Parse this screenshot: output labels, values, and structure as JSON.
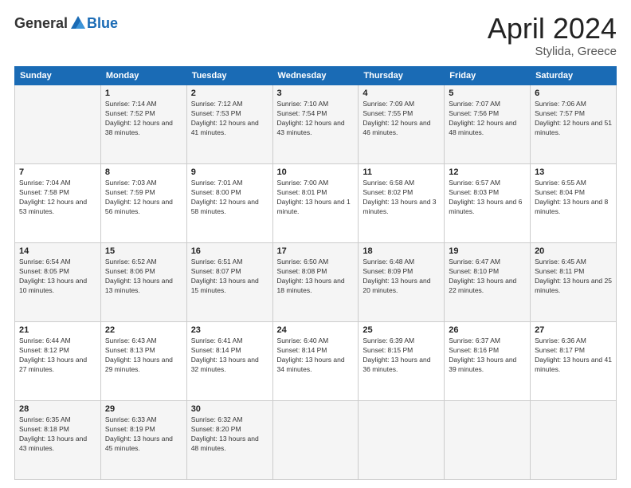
{
  "header": {
    "logo_general": "General",
    "logo_blue": "Blue",
    "month_title": "April 2024",
    "location": "Stylida, Greece"
  },
  "weekdays": [
    "Sunday",
    "Monday",
    "Tuesday",
    "Wednesday",
    "Thursday",
    "Friday",
    "Saturday"
  ],
  "weeks": [
    [
      {
        "day": "",
        "sunrise": "",
        "sunset": "",
        "daylight": ""
      },
      {
        "day": "1",
        "sunrise": "Sunrise: 7:14 AM",
        "sunset": "Sunset: 7:52 PM",
        "daylight": "Daylight: 12 hours and 38 minutes."
      },
      {
        "day": "2",
        "sunrise": "Sunrise: 7:12 AM",
        "sunset": "Sunset: 7:53 PM",
        "daylight": "Daylight: 12 hours and 41 minutes."
      },
      {
        "day": "3",
        "sunrise": "Sunrise: 7:10 AM",
        "sunset": "Sunset: 7:54 PM",
        "daylight": "Daylight: 12 hours and 43 minutes."
      },
      {
        "day": "4",
        "sunrise": "Sunrise: 7:09 AM",
        "sunset": "Sunset: 7:55 PM",
        "daylight": "Daylight: 12 hours and 46 minutes."
      },
      {
        "day": "5",
        "sunrise": "Sunrise: 7:07 AM",
        "sunset": "Sunset: 7:56 PM",
        "daylight": "Daylight: 12 hours and 48 minutes."
      },
      {
        "day": "6",
        "sunrise": "Sunrise: 7:06 AM",
        "sunset": "Sunset: 7:57 PM",
        "daylight": "Daylight: 12 hours and 51 minutes."
      }
    ],
    [
      {
        "day": "7",
        "sunrise": "Sunrise: 7:04 AM",
        "sunset": "Sunset: 7:58 PM",
        "daylight": "Daylight: 12 hours and 53 minutes."
      },
      {
        "day": "8",
        "sunrise": "Sunrise: 7:03 AM",
        "sunset": "Sunset: 7:59 PM",
        "daylight": "Daylight: 12 hours and 56 minutes."
      },
      {
        "day": "9",
        "sunrise": "Sunrise: 7:01 AM",
        "sunset": "Sunset: 8:00 PM",
        "daylight": "Daylight: 12 hours and 58 minutes."
      },
      {
        "day": "10",
        "sunrise": "Sunrise: 7:00 AM",
        "sunset": "Sunset: 8:01 PM",
        "daylight": "Daylight: 13 hours and 1 minute."
      },
      {
        "day": "11",
        "sunrise": "Sunrise: 6:58 AM",
        "sunset": "Sunset: 8:02 PM",
        "daylight": "Daylight: 13 hours and 3 minutes."
      },
      {
        "day": "12",
        "sunrise": "Sunrise: 6:57 AM",
        "sunset": "Sunset: 8:03 PM",
        "daylight": "Daylight: 13 hours and 6 minutes."
      },
      {
        "day": "13",
        "sunrise": "Sunrise: 6:55 AM",
        "sunset": "Sunset: 8:04 PM",
        "daylight": "Daylight: 13 hours and 8 minutes."
      }
    ],
    [
      {
        "day": "14",
        "sunrise": "Sunrise: 6:54 AM",
        "sunset": "Sunset: 8:05 PM",
        "daylight": "Daylight: 13 hours and 10 minutes."
      },
      {
        "day": "15",
        "sunrise": "Sunrise: 6:52 AM",
        "sunset": "Sunset: 8:06 PM",
        "daylight": "Daylight: 13 hours and 13 minutes."
      },
      {
        "day": "16",
        "sunrise": "Sunrise: 6:51 AM",
        "sunset": "Sunset: 8:07 PM",
        "daylight": "Daylight: 13 hours and 15 minutes."
      },
      {
        "day": "17",
        "sunrise": "Sunrise: 6:50 AM",
        "sunset": "Sunset: 8:08 PM",
        "daylight": "Daylight: 13 hours and 18 minutes."
      },
      {
        "day": "18",
        "sunrise": "Sunrise: 6:48 AM",
        "sunset": "Sunset: 8:09 PM",
        "daylight": "Daylight: 13 hours and 20 minutes."
      },
      {
        "day": "19",
        "sunrise": "Sunrise: 6:47 AM",
        "sunset": "Sunset: 8:10 PM",
        "daylight": "Daylight: 13 hours and 22 minutes."
      },
      {
        "day": "20",
        "sunrise": "Sunrise: 6:45 AM",
        "sunset": "Sunset: 8:11 PM",
        "daylight": "Daylight: 13 hours and 25 minutes."
      }
    ],
    [
      {
        "day": "21",
        "sunrise": "Sunrise: 6:44 AM",
        "sunset": "Sunset: 8:12 PM",
        "daylight": "Daylight: 13 hours and 27 minutes."
      },
      {
        "day": "22",
        "sunrise": "Sunrise: 6:43 AM",
        "sunset": "Sunset: 8:13 PM",
        "daylight": "Daylight: 13 hours and 29 minutes."
      },
      {
        "day": "23",
        "sunrise": "Sunrise: 6:41 AM",
        "sunset": "Sunset: 8:14 PM",
        "daylight": "Daylight: 13 hours and 32 minutes."
      },
      {
        "day": "24",
        "sunrise": "Sunrise: 6:40 AM",
        "sunset": "Sunset: 8:14 PM",
        "daylight": "Daylight: 13 hours and 34 minutes."
      },
      {
        "day": "25",
        "sunrise": "Sunrise: 6:39 AM",
        "sunset": "Sunset: 8:15 PM",
        "daylight": "Daylight: 13 hours and 36 minutes."
      },
      {
        "day": "26",
        "sunrise": "Sunrise: 6:37 AM",
        "sunset": "Sunset: 8:16 PM",
        "daylight": "Daylight: 13 hours and 39 minutes."
      },
      {
        "day": "27",
        "sunrise": "Sunrise: 6:36 AM",
        "sunset": "Sunset: 8:17 PM",
        "daylight": "Daylight: 13 hours and 41 minutes."
      }
    ],
    [
      {
        "day": "28",
        "sunrise": "Sunrise: 6:35 AM",
        "sunset": "Sunset: 8:18 PM",
        "daylight": "Daylight: 13 hours and 43 minutes."
      },
      {
        "day": "29",
        "sunrise": "Sunrise: 6:33 AM",
        "sunset": "Sunset: 8:19 PM",
        "daylight": "Daylight: 13 hours and 45 minutes."
      },
      {
        "day": "30",
        "sunrise": "Sunrise: 6:32 AM",
        "sunset": "Sunset: 8:20 PM",
        "daylight": "Daylight: 13 hours and 48 minutes."
      },
      {
        "day": "",
        "sunrise": "",
        "sunset": "",
        "daylight": ""
      },
      {
        "day": "",
        "sunrise": "",
        "sunset": "",
        "daylight": ""
      },
      {
        "day": "",
        "sunrise": "",
        "sunset": "",
        "daylight": ""
      },
      {
        "day": "",
        "sunrise": "",
        "sunset": "",
        "daylight": ""
      }
    ]
  ]
}
